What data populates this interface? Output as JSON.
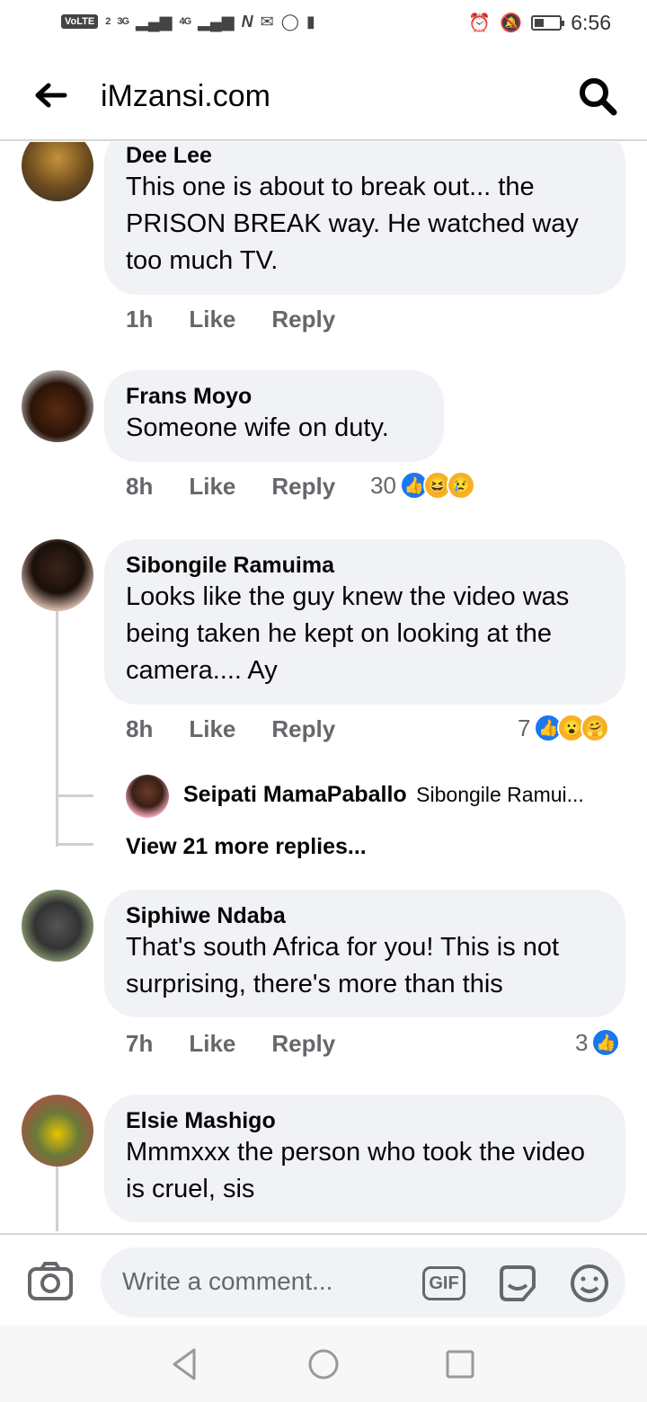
{
  "status": {
    "volte": "VoLTE",
    "sim": "2",
    "net1": "3G",
    "net2": "4G",
    "time": "6:56"
  },
  "header": {
    "title": "iMzansi.com"
  },
  "comments": [
    {
      "name": "Dee Lee",
      "text": "This one is about to break out... the PRISON BREAK way. He watched way too much TV.",
      "time": "1h",
      "like": "Like",
      "reply": "Reply",
      "reacts": ""
    },
    {
      "name": "Frans Moyo",
      "text": "Someone wife on duty.",
      "time": "8h",
      "like": "Like",
      "reply": "Reply",
      "reacts": "30"
    },
    {
      "name": "Sibongile Ramuima",
      "text": "Looks like the guy knew the video was being taken he kept on looking at the camera.... Ay",
      "time": "8h",
      "like": "Like",
      "reply": "Reply",
      "reacts": "7"
    },
    {
      "name": "Siphiwe Ndaba",
      "text": "That's south Africa for you! This is not surprising, there's more than this",
      "time": "7h",
      "like": "Like",
      "reply": "Reply",
      "reacts": "3"
    },
    {
      "name": "Elsie Mashigo",
      "text": "Mmmxxx the person who took the video is cruel, sis",
      "time": "",
      "like": "",
      "reply": "",
      "reacts": ""
    }
  ],
  "reply_preview": {
    "name": "Seipati MamaPaballo",
    "snippet": "Sibongile Ramui..."
  },
  "view_more": "View 21 more replies...",
  "composer": {
    "placeholder": "Write a comment...",
    "gif": "GIF"
  },
  "colors": {
    "bubble": "#f0f2f5",
    "meta": "#65676b",
    "like": "#1877f2"
  }
}
